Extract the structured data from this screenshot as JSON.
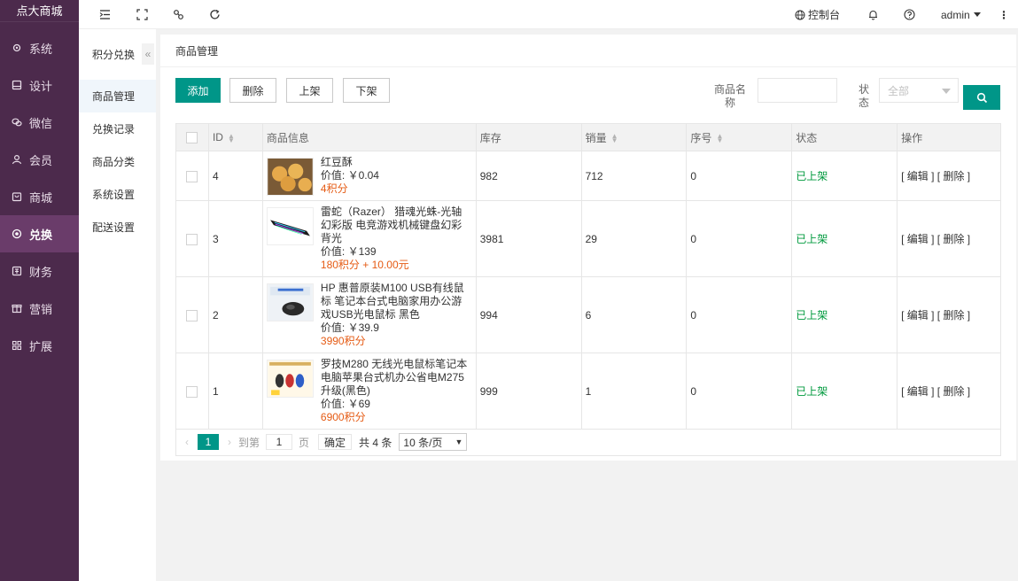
{
  "app": {
    "logo": "点大商城"
  },
  "sidebar": {
    "items": [
      {
        "label": "系统",
        "icon": "gear-icon"
      },
      {
        "label": "设计",
        "icon": "design-icon"
      },
      {
        "label": "微信",
        "icon": "wechat-icon"
      },
      {
        "label": "会员",
        "icon": "user-icon"
      },
      {
        "label": "商城",
        "icon": "shop-icon"
      },
      {
        "label": "兑换",
        "icon": "exchange-icon",
        "active": true
      },
      {
        "label": "财务",
        "icon": "finance-icon"
      },
      {
        "label": "营销",
        "icon": "marketing-icon"
      },
      {
        "label": "扩展",
        "icon": "extend-icon"
      }
    ]
  },
  "submenu": {
    "title": "积分兑换",
    "collapse": "«",
    "items": [
      "商品管理",
      "兑换记录",
      "商品分类",
      "系统设置",
      "配送设置"
    ]
  },
  "topbar": {
    "console": "控制台",
    "user": "admin",
    "more": "⋮"
  },
  "main": {
    "title": "商品管理",
    "buttons": {
      "add": "添加",
      "delete": "删除",
      "on_shelf": "上架",
      "off_shelf": "下架"
    },
    "filter": {
      "name_label": "商品名称",
      "status_label": "状态",
      "status_value": "全部"
    },
    "table": {
      "headers": {
        "id": "ID",
        "info": "商品信息",
        "stock": "库存",
        "sales": "销量",
        "order": "序号",
        "status": "状态",
        "ops": "操作"
      },
      "rows": [
        {
          "id": "4",
          "name": "红豆酥",
          "price": "价值: ￥0.04",
          "points": "4积分",
          "stock": "982",
          "sales": "712",
          "order": "0",
          "status": "已上架",
          "ops": "[ 编辑 ] [ 删除 ]",
          "thumb": "pastry"
        },
        {
          "id": "3",
          "name": "雷蛇（Razer） 猎魂光蛛-光轴幻彩版 电竞游戏机械键盘幻彩背光",
          "price": "价值: ￥139",
          "points": "180积分 + 10.00元",
          "stock": "3981",
          "sales": "29",
          "order": "0",
          "status": "已上架",
          "ops": "[ 编辑 ] [ 删除 ]",
          "thumb": "keyboard"
        },
        {
          "id": "2",
          "name": "HP 惠普原装M100 USB有线鼠标 笔记本台式电脑家用办公游戏USB光电鼠标 黑色",
          "price": "价值: ￥39.9",
          "points": "3990积分",
          "stock": "994",
          "sales": "6",
          "order": "0",
          "status": "已上架",
          "ops": "[ 编辑 ] [ 删除 ]",
          "thumb": "mouse"
        },
        {
          "id": "1",
          "name": "罗技M280 无线光电鼠标笔记本电脑苹果台式机办公省电M275升级(黑色)",
          "price": "价值: ￥69",
          "points": "6900积分",
          "stock": "999",
          "sales": "1",
          "order": "0",
          "status": "已上架",
          "ops": "[ 编辑 ] [ 删除 ]",
          "thumb": "mice"
        }
      ]
    },
    "pager": {
      "current": "1",
      "goto_label": "到第",
      "page_input": "1",
      "page_unit": "页",
      "confirm": "确定",
      "total": "共 4 条",
      "page_size": "10 条/页"
    }
  },
  "colors": {
    "sidebar": "#4c2a4c",
    "accent": "#009688",
    "points": "#e55b14",
    "status_on": "#009a3e"
  }
}
